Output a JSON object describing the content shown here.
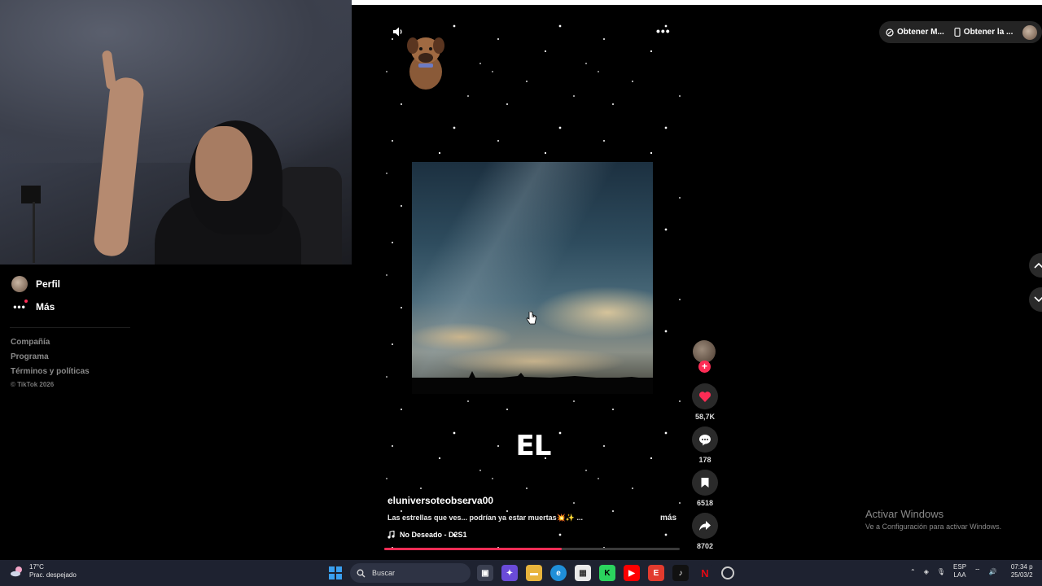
{
  "sidebar": {
    "items": [
      {
        "label": "Perfil",
        "icon": "avatar-icon"
      },
      {
        "label": "Más",
        "icon": "more-dots-icon"
      }
    ],
    "footer": [
      "Compañía",
      "Programa",
      "Términos y políticas"
    ],
    "copyright": "© TikTok 2026"
  },
  "extensions": {
    "pill1": "Obtener M...",
    "pill2": "Obtener la ..."
  },
  "video": {
    "overlay_word": "EL",
    "username": "eluniversoteobserva00",
    "caption": "Las estrellas que ves... podrían ya estar muertas💥✨ ...",
    "more_label": "más",
    "music": "No Deseado - D2S1",
    "progress": 0.6
  },
  "actions": {
    "likes": "58,7K",
    "comments": "178",
    "saves": "6518",
    "shares": "8702"
  },
  "watermark": {
    "title": "Activar Windows",
    "subtitle": "Ve a Configuración para activar Windows."
  },
  "taskbar": {
    "temperature": "17°C",
    "weather": "Prac. despejado",
    "search_label": "Buscar",
    "lang_line1": "ESP",
    "lang_line2": "LAA",
    "time": "07:34 p",
    "date": "25/03/2"
  },
  "colors": {
    "accent": "#fe2c55",
    "taskbar": "#1e2230"
  }
}
